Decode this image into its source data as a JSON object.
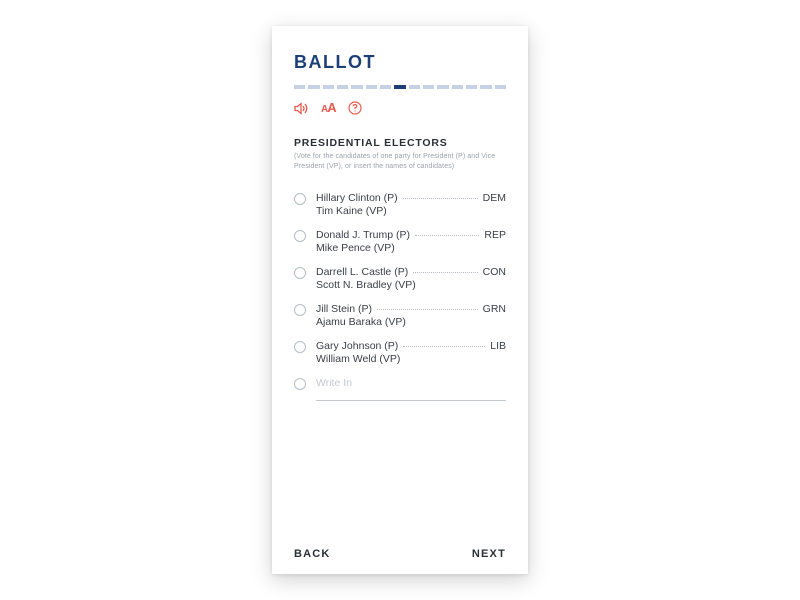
{
  "title": "BALLOT",
  "progress": {
    "total": 15,
    "current": 8
  },
  "section": {
    "heading": "PRESIDENTIAL ELECTORS",
    "sub": "(Vote for the candidates of one party for President (P) and Vice President (VP), or insert the names of candidates)"
  },
  "options": [
    {
      "p": "Hillary Clinton (P)",
      "vp": "Tim Kaine (VP)",
      "party": "DEM"
    },
    {
      "p": "Donald J. Trump (P)",
      "vp": "Mike Pence (VP)",
      "party": "REP"
    },
    {
      "p": "Darrell L. Castle (P)",
      "vp": "Scott N. Bradley (VP)",
      "party": "CON"
    },
    {
      "p": "Jill Stein (P)",
      "vp": "Ajamu Baraka (VP)",
      "party": "GRN"
    },
    {
      "p": "Gary Johnson (P)",
      "vp": "William Weld (VP)",
      "party": "LIB"
    }
  ],
  "writein_label": "Write In",
  "footer": {
    "back": "BACK",
    "next": "NEXT"
  }
}
